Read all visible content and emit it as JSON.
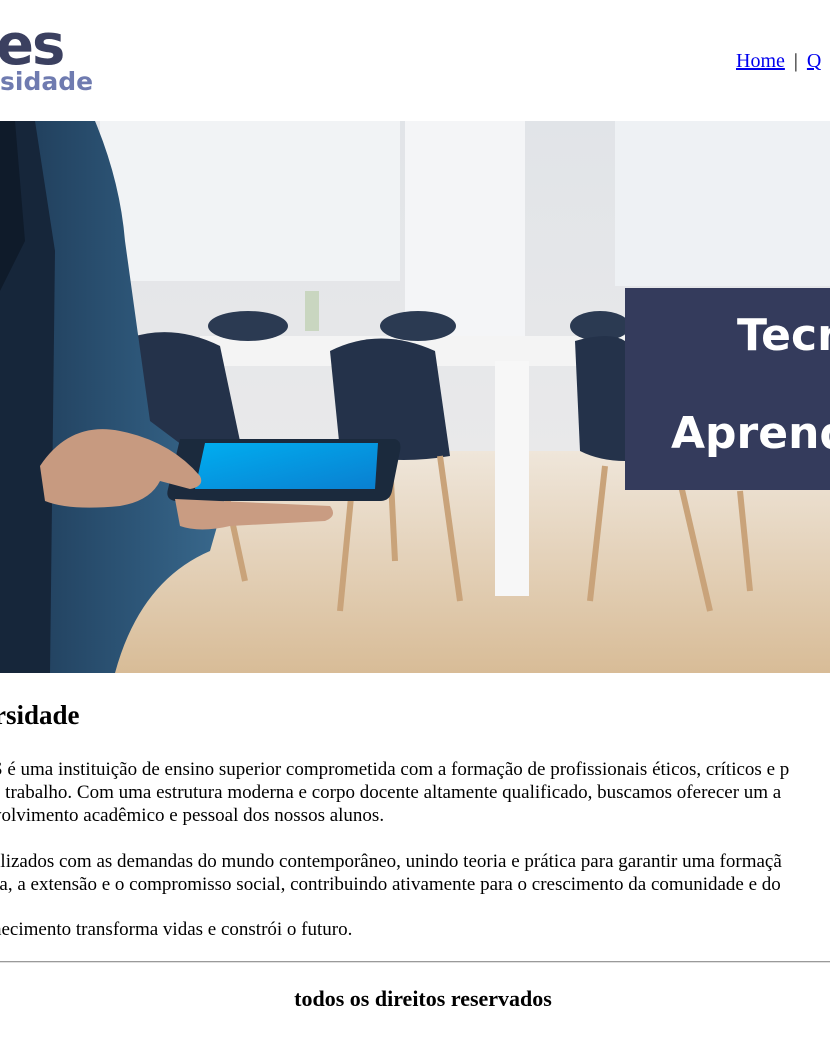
{
  "header": {
    "logo": {
      "line1": "es",
      "line2": "sidade"
    },
    "nav": {
      "home": "Home",
      "separator": "|",
      "next_partial": "Q"
    }
  },
  "hero": {
    "banner_line1": "Tecn",
    "banner_line2": "Aprend"
  },
  "about": {
    "title": "rsidade",
    "p1_line1": "S é uma instituição de ensino superior comprometida com a formação de profissionais éticos, críticos e p",
    "p1_line2": "e trabalho. Com uma estrutura moderna e corpo docente altamente qualificado, buscamos oferecer um a",
    "p1_line3": "volvimento acadêmico e pessoal dos nossos alunos.",
    "p2_line1": "alizados com as demandas do mundo contemporâneo, unindo teoria e prática para garantir uma formaçã",
    "p2_line2": "sa, a extensão e o compromisso social, contribuindo ativamente para o crescimento da comunidade e do",
    "p3_line1": "hecimento transforma vidas e constrói o futuro."
  },
  "footer": {
    "text": "todos os direitos reservados"
  }
}
